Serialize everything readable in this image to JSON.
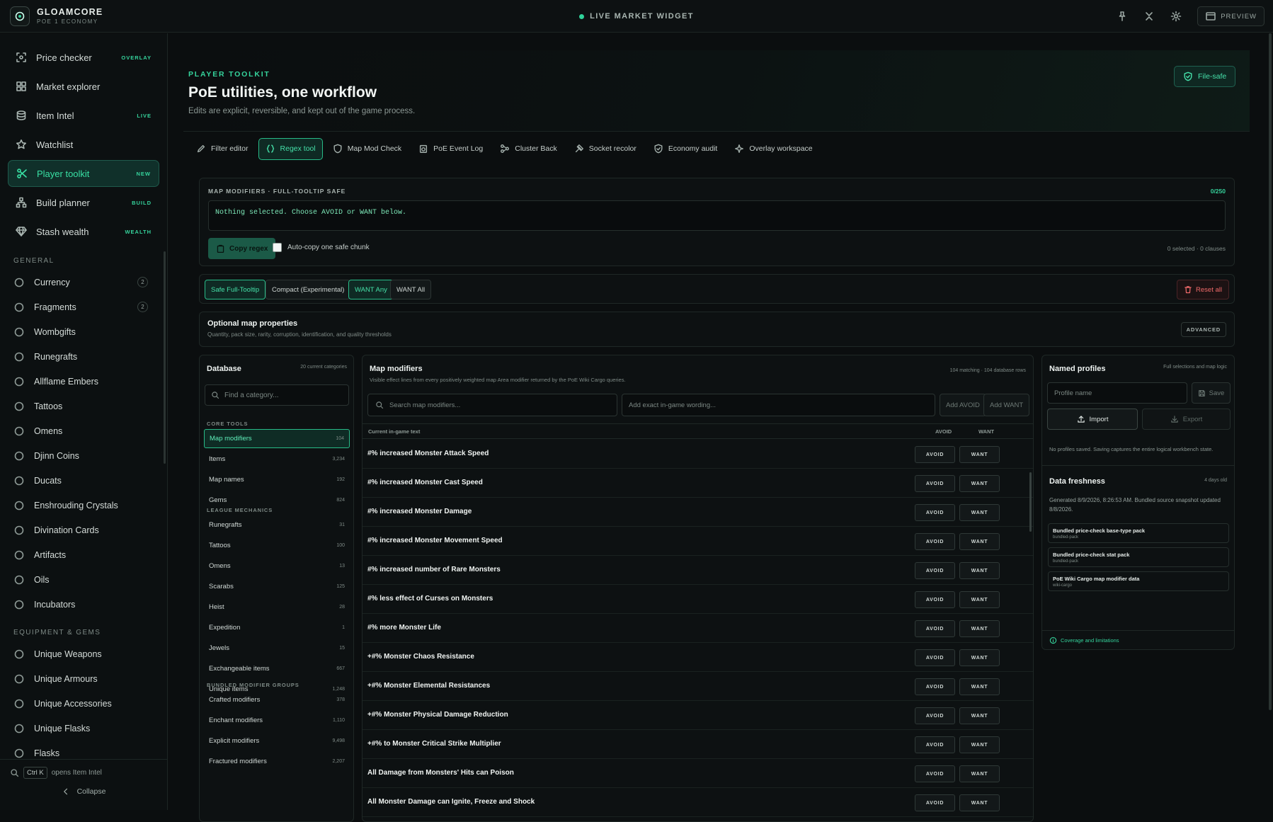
{
  "app": {
    "name": "GLOAMCORE",
    "subtitle": "POE 1 ECONOMY",
    "widget_title": "LIVE MARKET WIDGET",
    "preview_label": "PREVIEW"
  },
  "nav": [
    {
      "label": "Price checker",
      "badge": "OVERLAY",
      "icon": "crosshair-icon"
    },
    {
      "label": "Market explorer",
      "badge": "",
      "icon": "grid-icon"
    },
    {
      "label": "Item Intel",
      "badge": "LIVE",
      "icon": "database-icon"
    },
    {
      "label": "Watchlist",
      "badge": "",
      "icon": "star-icon"
    },
    {
      "label": "Player toolkit",
      "badge": "NEW",
      "icon": "scissors-icon",
      "active": true
    },
    {
      "label": "Build planner",
      "badge": "BUILD",
      "icon": "hierarchy-icon"
    },
    {
      "label": "Stash wealth",
      "badge": "WEALTH",
      "icon": "gem-icon"
    }
  ],
  "sections": {
    "general": "GENERAL",
    "equipment": "EQUIPMENT & GEMS"
  },
  "general_items": [
    {
      "label": "Currency",
      "count": "2"
    },
    {
      "label": "Fragments",
      "count": "2"
    },
    {
      "label": "Wombgifts",
      "count": ""
    },
    {
      "label": "Runegrafts",
      "count": ""
    },
    {
      "label": "Allflame Embers",
      "count": ""
    },
    {
      "label": "Tattoos",
      "count": ""
    },
    {
      "label": "Omens",
      "count": ""
    },
    {
      "label": "Djinn Coins",
      "count": ""
    },
    {
      "label": "Ducats",
      "count": ""
    },
    {
      "label": "Enshrouding Crystals",
      "count": ""
    },
    {
      "label": "Divination Cards",
      "count": ""
    },
    {
      "label": "Artifacts",
      "count": ""
    },
    {
      "label": "Oils",
      "count": ""
    },
    {
      "label": "Incubators",
      "count": ""
    }
  ],
  "equipment_items": [
    {
      "label": "Unique Weapons"
    },
    {
      "label": "Unique Armours"
    },
    {
      "label": "Unique Accessories"
    },
    {
      "label": "Unique Flasks"
    },
    {
      "label": "Flasks"
    }
  ],
  "sidebar_bottom": {
    "kbd": "Ctrl K",
    "hint": "opens Item Intel",
    "collapse": "Collapse"
  },
  "hero": {
    "eyebrow": "PLAYER TOOLKIT",
    "title": "PoE utilities, one workflow",
    "subtitle": "Edits are explicit, reversible, and kept out of the game process.",
    "filesafe": "File-safe"
  },
  "tabs": [
    {
      "label": "Filter editor"
    },
    {
      "label": "Regex tool",
      "active": true
    },
    {
      "label": "Map Mod Check"
    },
    {
      "label": "PoE Event Log"
    },
    {
      "label": "Cluster Back"
    },
    {
      "label": "Socket recolor"
    },
    {
      "label": "Economy audit"
    },
    {
      "label": "Overlay workspace"
    }
  ],
  "regex": {
    "label": "MAP MODIFIERS · FULL-TOOLTIP SAFE",
    "count": "0/250",
    "output": "Nothing selected. Choose AVOID or WANT below.",
    "copy_label": "Copy regex",
    "autocopy_label": "Auto-copy one safe chunk",
    "selection_info": "0 selected · 0 clauses"
  },
  "modes": {
    "safe": "Safe Full-Tooltip",
    "compact": "Compact (Experimental)",
    "want_any": "WANT Any",
    "want_all": "WANT All",
    "reset": "Reset all"
  },
  "optional": {
    "title": "Optional map properties",
    "subtitle": "Quantity, pack size, rarity, corruption, identification, and quality thresholds",
    "advanced": "ADVANCED"
  },
  "database": {
    "title": "Database",
    "meta": "20 current categories",
    "search_placeholder": "Find a category...",
    "groups": [
      {
        "name": "CORE TOOLS",
        "items": [
          {
            "label": "Map modifiers",
            "count": "104",
            "active": true
          },
          {
            "label": "Items",
            "count": "3,234"
          },
          {
            "label": "Map names",
            "count": "192"
          },
          {
            "label": "Gems",
            "count": "824"
          }
        ]
      },
      {
        "name": "LEAGUE MECHANICS",
        "items": [
          {
            "label": "Runegrafts",
            "count": "31"
          },
          {
            "label": "Tattoos",
            "count": "100"
          },
          {
            "label": "Omens",
            "count": "13"
          },
          {
            "label": "Scarabs",
            "count": "125"
          },
          {
            "label": "Heist",
            "count": "28"
          },
          {
            "label": "Expedition",
            "count": "1"
          },
          {
            "label": "Jewels",
            "count": "15"
          },
          {
            "label": "Exchangeable items",
            "count": "667"
          },
          {
            "label": "Unique items",
            "count": "1,248"
          }
        ]
      },
      {
        "name": "BUNDLED MODIFIER GROUPS",
        "items": [
          {
            "label": "Crafted modifiers",
            "count": "378"
          },
          {
            "label": "Enchant modifiers",
            "count": "1,110"
          },
          {
            "label": "Explicit modifiers",
            "count": "9,498"
          },
          {
            "label": "Fractured modifiers",
            "count": "2,207"
          }
        ]
      }
    ]
  },
  "map_modifiers": {
    "title": "Map modifiers",
    "subtitle": "Visible effect lines from every positively weighted map Area modifier returned by the PoE Wiki Cargo queries.",
    "meta": "104 matching · 104 database rows",
    "search_placeholder": "Search map modifiers...",
    "add_placeholder": "Add exact in-game wording...",
    "add_avoid": "Add AVOID",
    "add_want": "Add WANT",
    "col_text": "Current in-game text",
    "col_avoid": "AVOID",
    "col_want": "WANT",
    "avoid_label": "AVOID",
    "want_label": "WANT",
    "rows": [
      "#% increased Monster Attack Speed",
      "#% increased Monster Cast Speed",
      "#% increased Monster Damage",
      "#% increased Monster Movement Speed",
      "#% increased number of Rare Monsters",
      "#% less effect of Curses on Monsters",
      "#% more Monster Life",
      "+#% Monster Chaos Resistance",
      "+#% Monster Elemental Resistances",
      "+#% Monster Physical Damage Reduction",
      "+#% to Monster Critical Strike Multiplier",
      "All Damage from Monsters' Hits can Poison",
      "All Monster Damage can Ignite, Freeze and Shock"
    ]
  },
  "profiles": {
    "title": "Named profiles",
    "meta": "Full selections and map logic",
    "name_placeholder": "Profile name",
    "save": "Save",
    "import": "Import",
    "export": "Export",
    "empty": "No profiles saved. Saving captures the entire logical workbench state."
  },
  "freshness": {
    "title": "Data freshness",
    "age": "4 days old",
    "generated": "Generated 8/9/2026, 8:26:53 AM. Bundled source snapshot updated 8/8/2026.",
    "sources": [
      {
        "name": "Bundled price-check base-type pack",
        "tag": "bundled-pack"
      },
      {
        "name": "Bundled price-check stat pack",
        "tag": "bundled-pack"
      },
      {
        "name": "PoE Wiki Cargo map modifier data",
        "tag": "wiki-cargo"
      }
    ],
    "coverage": "Coverage and limitations"
  },
  "colors": {
    "accent": "#35d39c",
    "danger": "#f06a6a",
    "background": "#0b0e0f"
  }
}
